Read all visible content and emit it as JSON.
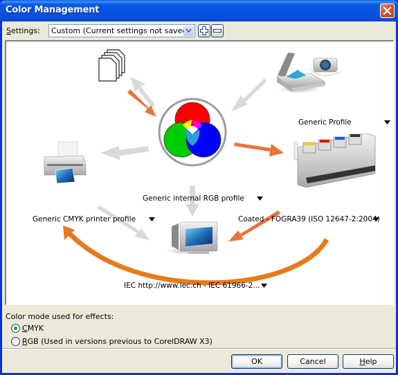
{
  "window": {
    "title": "Color Management",
    "close_label": "close"
  },
  "settings": {
    "label_accel": "S",
    "label_rest": "ettings:",
    "selected": "Custom (Current settings not saved)",
    "add_label": "add-preset",
    "remove_label": "remove-preset"
  },
  "diagram": {
    "nodes": [
      {
        "id": "documents",
        "icon": "documents-icon",
        "label": ""
      },
      {
        "id": "input",
        "icon": "scanner-camera-icon",
        "label": "Generic Profile"
      },
      {
        "id": "rgb",
        "icon": "rgb-circles-icon",
        "label": "Generic internal RGB profile"
      },
      {
        "id": "printer",
        "icon": "printer-icon",
        "label": "Generic CMYK printer profile"
      },
      {
        "id": "press",
        "icon": "printing-press-icon",
        "label": "Coated - FOGRA39 (ISO 12647-2:2004)"
      },
      {
        "id": "monitor",
        "icon": "monitor-icon",
        "label": "IEC http://www.iec.ch - IEC 61966-2..."
      }
    ],
    "colors": {
      "active_arrow": "#e8743b",
      "inactive_arrow": "#d9d9d9",
      "loop_arrow": "#e87a1e"
    }
  },
  "effects": {
    "label": "Color mode used for effects:",
    "options": [
      {
        "accel": "C",
        "rest": "MYK",
        "checked": true
      },
      {
        "accel": "R",
        "rest": "GB (Used in versions previous to CorelDRAW X3)",
        "checked": false
      }
    ]
  },
  "buttons": {
    "ok": "OK",
    "cancel": "Cancel",
    "help_accel": "H",
    "help_rest": "elp"
  }
}
